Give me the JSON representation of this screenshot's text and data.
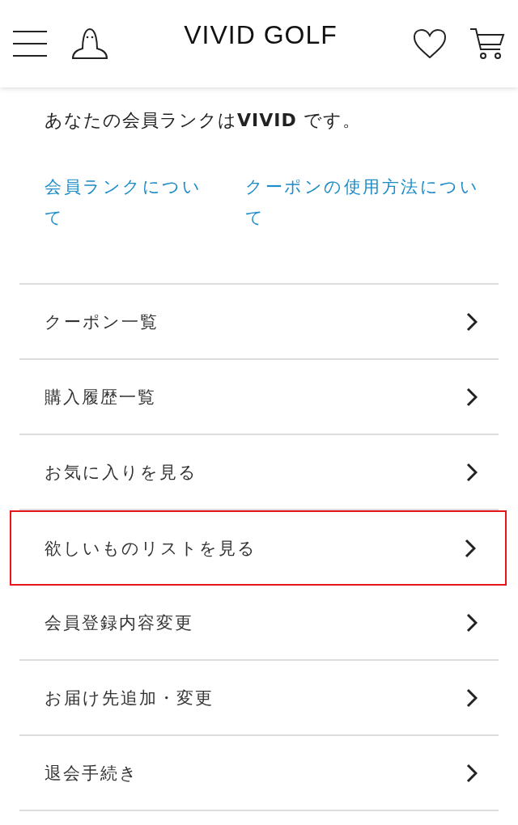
{
  "header": {
    "logo": "VIVID GOLF"
  },
  "rank_message": "あなたの会員ランクは**VIVID** です。",
  "links": [
    "会員ランクについて",
    "クーポンの使用方法について"
  ],
  "menu": [
    {
      "label": "クーポン一覧",
      "highlighted": false
    },
    {
      "label": "購入履歴一覧",
      "highlighted": false
    },
    {
      "label": "お気に入りを見る",
      "highlighted": false
    },
    {
      "label": "欲しいものリストを見る",
      "highlighted": true
    },
    {
      "label": "会員登録内容変更",
      "highlighted": false
    },
    {
      "label": "お届け先追加・変更",
      "highlighted": false
    },
    {
      "label": "退会手続き",
      "highlighted": false
    }
  ]
}
